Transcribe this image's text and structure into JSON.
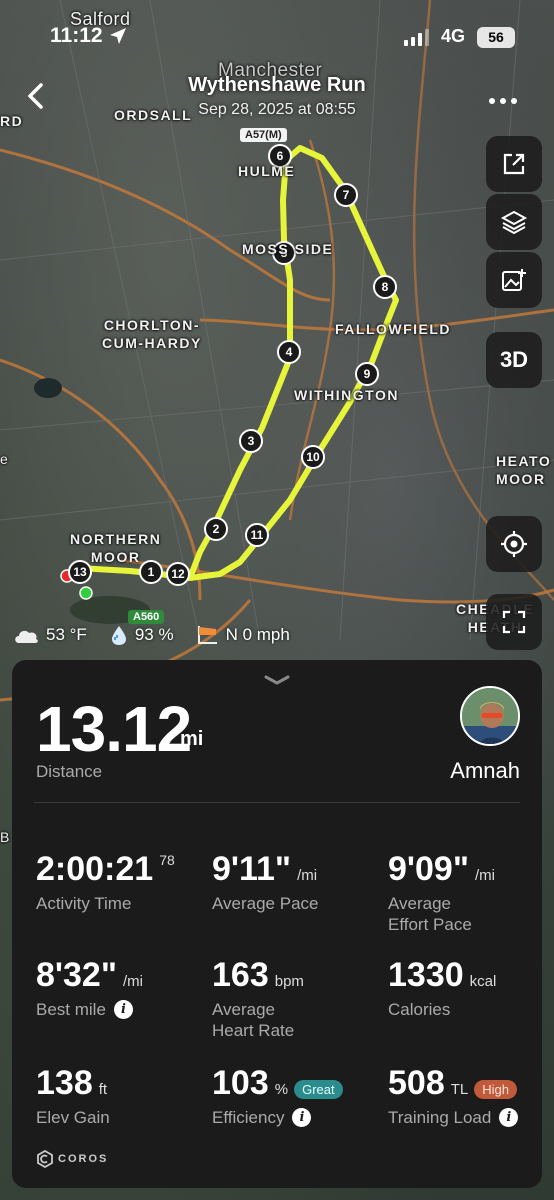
{
  "status_bar": {
    "time": "11:12",
    "network": "4G",
    "battery": "56"
  },
  "header": {
    "title": "Wythenshawe Run",
    "subtitle": "Sep 28, 2025 at 08:55"
  },
  "map": {
    "places": {
      "salford": "Salford",
      "manchester": "Manchester",
      "ordsall": "ORDSALL",
      "hulme": "HULME",
      "moss_side": "MOSS SIDE",
      "chorlton": "CHORLTON-\nCUM-HARDY",
      "fallowfield": "FALLOWFIELD",
      "withington": "WITHINGTON",
      "heaton_moor": "HEATO\nMOOR",
      "northern_moor": "NORTHERN\nMOOR",
      "cheadle_heath": "CHEADLE\nHEATH",
      "edge_rd": "RD",
      "edge_e": "e",
      "edge_b": "B"
    },
    "road_labels": {
      "a57m": "A57(M)",
      "a560": "A560"
    },
    "route_color": "#e6f53a",
    "markers": [
      "1",
      "2",
      "3",
      "4",
      "5",
      "6",
      "7",
      "8",
      "9",
      "10",
      "11",
      "12",
      "13"
    ],
    "buttons": {
      "three_d": "3D"
    }
  },
  "weather": {
    "temperature": "53 °F",
    "humidity": "93 %",
    "wind": "N 0 mph"
  },
  "summary": {
    "distance": {
      "value": "13.12",
      "unit": "mi",
      "label": "Distance"
    },
    "user_name": "Amnah"
  },
  "stats": {
    "activity_time": {
      "value": "2:00:21",
      "sup": "78",
      "label": "Activity Time"
    },
    "average_pace": {
      "value": "9'11\"",
      "unit": "/mi",
      "label": "Average Pace"
    },
    "effort_pace": {
      "value": "9'09\"",
      "unit": "/mi",
      "label": "Average\nEffort Pace"
    },
    "best_mile": {
      "value": "8'32\"",
      "unit": "/mi",
      "label": "Best mile"
    },
    "heart_rate": {
      "value": "163",
      "unit": "bpm",
      "label": "Average\nHeart Rate"
    },
    "calories": {
      "value": "1330",
      "unit": "kcal",
      "label": "Calories"
    },
    "elev_gain": {
      "value": "138",
      "unit": "ft",
      "label": "Elev Gain"
    },
    "efficiency": {
      "value": "103",
      "unit": "%",
      "badge": "Great",
      "badge_color": "#2a8c8c",
      "label": "Efficiency"
    },
    "training_load": {
      "value": "508",
      "unit": "TL",
      "badge": "High",
      "badge_color": "#c05a3a",
      "label": "Training Load"
    }
  },
  "brand": "COROS"
}
